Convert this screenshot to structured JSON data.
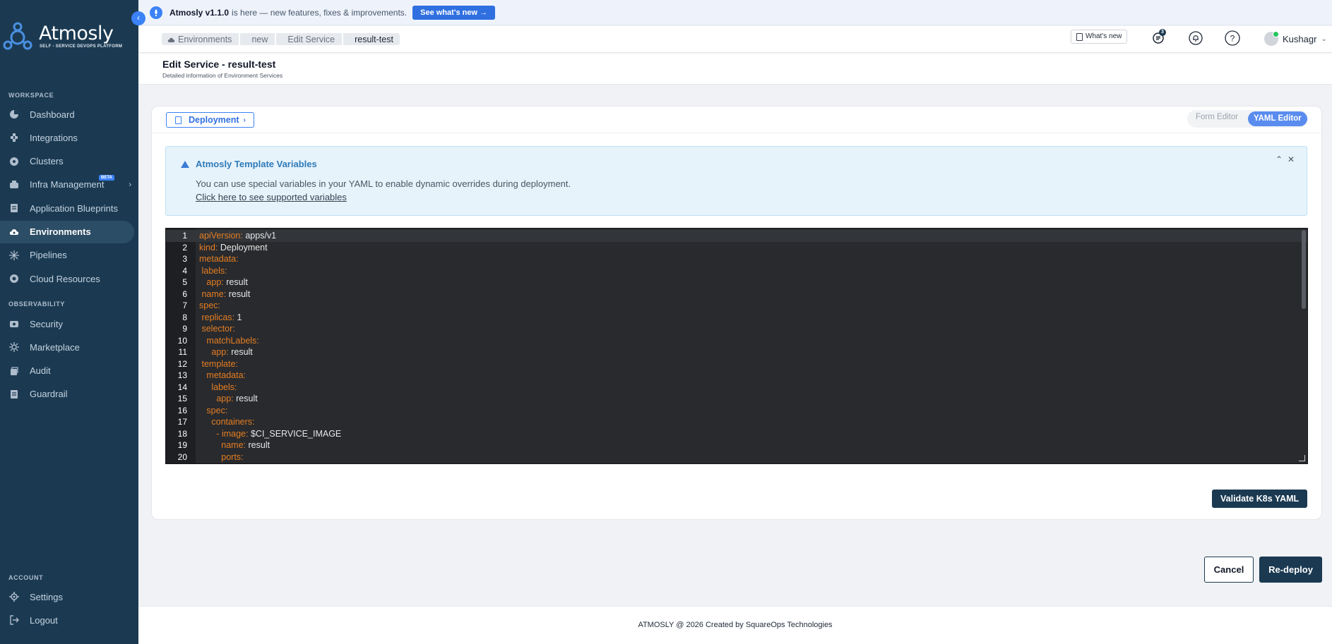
{
  "app": {
    "name": "Atmosly",
    "tagline": "SELF - SERVICE DEVOPS PLATFORM"
  },
  "banner": {
    "version": "Atmosly v1.1.0",
    "text": "is here — new features, fixes & improvements.",
    "button": "See what's new →"
  },
  "sidebar": {
    "workspace_title": "WORKSPACE",
    "workspace_items": [
      {
        "label": "Dashboard",
        "icon": "pie-chart-icon"
      },
      {
        "label": "Integrations",
        "icon": "puzzle-icon"
      },
      {
        "label": "Clusters",
        "icon": "cluster-icon"
      },
      {
        "label": "Infra Management",
        "icon": "infra-icon",
        "badge": "BETA"
      },
      {
        "label": "Application Blueprints",
        "icon": "blueprint-icon"
      },
      {
        "label": "Environments",
        "icon": "cloud-icon",
        "active": true
      },
      {
        "label": "Pipelines",
        "icon": "pipeline-icon"
      },
      {
        "label": "Cloud Resources",
        "icon": "cloud-resource-icon"
      }
    ],
    "observability_title": "OBSERVABILITY",
    "observability_items": [
      {
        "label": "Security",
        "icon": "shield-icon"
      },
      {
        "label": "Marketplace",
        "icon": "marketplace-icon"
      },
      {
        "label": "Audit",
        "icon": "audit-icon"
      },
      {
        "label": "Guardrail",
        "icon": "guardrail-icon"
      }
    ],
    "account_title": "ACCOUNT",
    "account_items": [
      {
        "label": "Settings",
        "icon": "gear-icon"
      },
      {
        "label": "Logout",
        "icon": "logout-icon"
      }
    ]
  },
  "header": {
    "breadcrumb": [
      "Environments",
      "new",
      "Edit Service",
      "result-test"
    ],
    "whats_new": "What's new",
    "changelog_badge": "3",
    "user_name": "Kushagr"
  },
  "page": {
    "title": "Edit Service - result-test",
    "subtitle": "Detailed information of Environment Services"
  },
  "card": {
    "resource_button": "Deployment",
    "editor_toggle": {
      "form": "Form Editor",
      "yaml": "YAML Editor",
      "selected": "YAML Editor"
    },
    "alert": {
      "title": "Atmosly Template Variables",
      "text": "You can use special variables in your YAML to enable dynamic overrides during deployment.",
      "link": "Click here to see supported variables"
    },
    "yaml_lines": [
      {
        "n": "1",
        "indent": "",
        "key": "apiVersion",
        "value": "apps/v1"
      },
      {
        "n": "2",
        "indent": "",
        "key": "kind",
        "value": "Deployment"
      },
      {
        "n": "3",
        "indent": "",
        "key": "metadata",
        "value": ""
      },
      {
        "n": "4",
        "indent": " ",
        "key": "labels",
        "value": ""
      },
      {
        "n": "5",
        "indent": "   ",
        "key": "app",
        "value": "result"
      },
      {
        "n": "6",
        "indent": " ",
        "key": "name",
        "value": "result"
      },
      {
        "n": "7",
        "indent": "",
        "key": "spec",
        "value": ""
      },
      {
        "n": "8",
        "indent": " ",
        "key": "replicas",
        "value": "1"
      },
      {
        "n": "9",
        "indent": " ",
        "key": "selector",
        "value": ""
      },
      {
        "n": "10",
        "indent": "   ",
        "key": "matchLabels",
        "value": ""
      },
      {
        "n": "11",
        "indent": "     ",
        "key": "app",
        "value": "result"
      },
      {
        "n": "12",
        "indent": " ",
        "key": "template",
        "value": ""
      },
      {
        "n": "13",
        "indent": "   ",
        "key": "metadata",
        "value": ""
      },
      {
        "n": "14",
        "indent": "     ",
        "key": "labels",
        "value": ""
      },
      {
        "n": "15",
        "indent": "       ",
        "key": "app",
        "value": "result"
      },
      {
        "n": "16",
        "indent": "   ",
        "key": "spec",
        "value": ""
      },
      {
        "n": "17",
        "indent": "     ",
        "key": "containers",
        "value": ""
      },
      {
        "n": "18",
        "indent": "       - ",
        "key": "image",
        "value": "$CI_SERVICE_IMAGE"
      },
      {
        "n": "19",
        "indent": "         ",
        "key": "name",
        "value": "result"
      },
      {
        "n": "20",
        "indent": "         ",
        "key": "ports",
        "value": ""
      }
    ],
    "validate_button": "Validate K8s YAML"
  },
  "actions": {
    "cancel": "Cancel",
    "redeploy": "Re-deploy"
  },
  "footer": {
    "text": "ATMOSLY @ 2026 Created by SquareOps Technologies"
  },
  "colors": {
    "sidebar_bg": "#1b3a52",
    "accent": "#3b82f6",
    "yaml_key": "#e67e22",
    "editor_bg": "#282a2e"
  }
}
